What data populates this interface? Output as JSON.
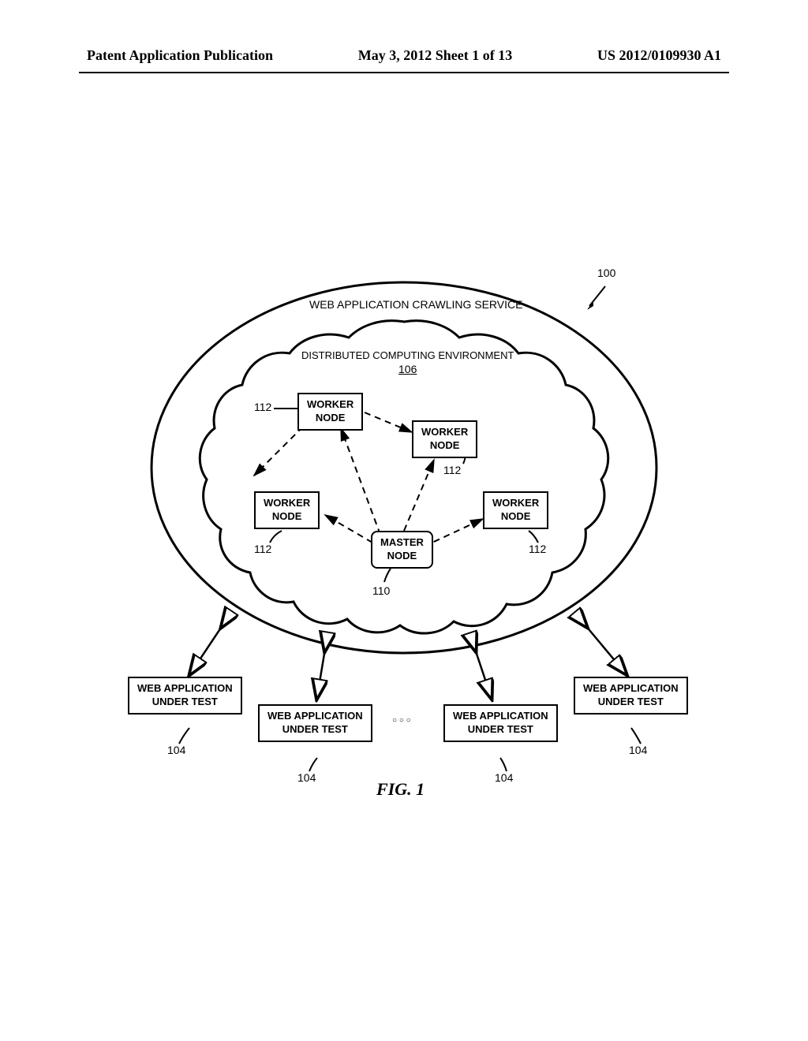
{
  "header": {
    "left": "Patent Application Publication",
    "center": "May 3, 2012  Sheet 1 of 13",
    "right": "US 2012/0109930 A1"
  },
  "diagram": {
    "service_title": "WEB APPLICATION CRAWLING SERVICE",
    "env_title_line1": "DISTRIBUTED COMPUTING ENVIRONMENT",
    "env_title_ref": "106",
    "worker_node": "WORKER\nNODE",
    "master_node": "MASTER\nNODE",
    "web_app": "WEB APPLICATION\nUNDER TEST",
    "ref_100": "100",
    "ref_112_tl": "112",
    "ref_112_tr": "112",
    "ref_112_bl": "112",
    "ref_112_br": "112",
    "ref_110": "110",
    "ref_104_1": "104",
    "ref_104_2": "104",
    "ref_104_3": "104",
    "ref_104_4": "104",
    "ellipsis": "○  ○  ○",
    "fig_label": "FIG. 1"
  }
}
